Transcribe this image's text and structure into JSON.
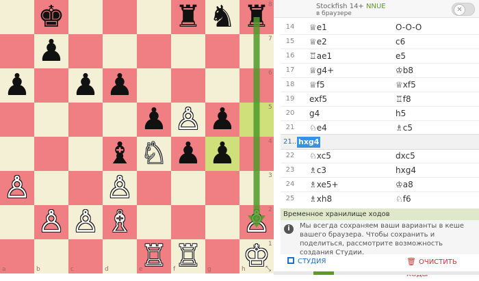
{
  "engine": {
    "name": "Stockfish 14+",
    "tag": "NNUE",
    "sub": "в браузере"
  },
  "moves": [
    {
      "num": "14",
      "w": "♕e1",
      "b": "O-O-O"
    },
    {
      "num": "15",
      "w": "♕e2",
      "b": "c6"
    },
    {
      "num": "16",
      "w": "♖ae1",
      "b": "e5"
    },
    {
      "num": "17",
      "w": "♕g4+",
      "b": "♔b8"
    },
    {
      "num": "18",
      "w": "♕f5",
      "b": "♕xf5"
    },
    {
      "num": "19",
      "w": "exf5",
      "b": "♖f8"
    },
    {
      "num": "20",
      "w": "g4",
      "b": "h5"
    },
    {
      "num": "21",
      "w": "♘e4",
      "b": "♗c5"
    }
  ],
  "variation": {
    "num": "21...",
    "move": "hxg4"
  },
  "moves2": [
    {
      "num": "22",
      "w": "♘xc5",
      "b": "dxc5"
    },
    {
      "num": "23",
      "w": "♗c3",
      "b": "hxg4"
    },
    {
      "num": "24",
      "w": "♗xe5+",
      "b": "♔a8"
    },
    {
      "num": "25",
      "w": "♗xh8",
      "b": "♘f6"
    }
  ],
  "storage": {
    "header": "Временное хранилище ходов",
    "text": "Мы всегда сохраняем ваши варианты в кеше вашего браузера. Чтобы сохранить и поделиться, рассмотрите возможность создания Студии.",
    "studio_label": "СТУДИЯ",
    "clear_label": "ОЧИСТИТЬ ХОДЫ"
  },
  "board": {
    "files": [
      "a",
      "b",
      "c",
      "d",
      "e",
      "f",
      "g",
      "h"
    ],
    "ranks": [
      "8",
      "7",
      "6",
      "5",
      "4",
      "3",
      "2",
      "1"
    ],
    "highlight_squares": [
      "h5",
      "g4"
    ],
    "pieces": [
      {
        "sq": "b8",
        "p": "♚",
        "c": "b"
      },
      {
        "sq": "f8",
        "p": "♜",
        "c": "b"
      },
      {
        "sq": "g8",
        "p": "♞",
        "c": "b"
      },
      {
        "sq": "h8",
        "p": "♜",
        "c": "b"
      },
      {
        "sq": "b7",
        "p": "♟",
        "c": "b"
      },
      {
        "sq": "a6",
        "p": "♟",
        "c": "b"
      },
      {
        "sq": "c6",
        "p": "♟",
        "c": "b"
      },
      {
        "sq": "d6",
        "p": "♟",
        "c": "b"
      },
      {
        "sq": "e5",
        "p": "♟",
        "c": "b"
      },
      {
        "sq": "f5",
        "p": "♙",
        "c": "w"
      },
      {
        "sq": "g5",
        "p": "♟",
        "c": "b"
      },
      {
        "sq": "d4",
        "p": "♝",
        "c": "b"
      },
      {
        "sq": "e4",
        "p": "♘",
        "c": "w"
      },
      {
        "sq": "f4",
        "p": "♟",
        "c": "b"
      },
      {
        "sq": "g4",
        "p": "♟",
        "c": "b"
      },
      {
        "sq": "a3",
        "p": "♙",
        "c": "w"
      },
      {
        "sq": "d3",
        "p": "♙",
        "c": "w"
      },
      {
        "sq": "b2",
        "p": "♙",
        "c": "w"
      },
      {
        "sq": "c2",
        "p": "♙",
        "c": "w"
      },
      {
        "sq": "d2",
        "p": "♗",
        "c": "w"
      },
      {
        "sq": "h2",
        "p": "♙",
        "c": "w"
      },
      {
        "sq": "e1",
        "p": "♖",
        "c": "w"
      },
      {
        "sq": "f1",
        "p": "♖",
        "c": "w"
      },
      {
        "sq": "h1",
        "p": "♔",
        "c": "w"
      }
    ],
    "arrow": {
      "from": "h8",
      "to": "h2",
      "color": "#4e9a2c"
    }
  },
  "colors": {
    "light": "#f3f0d6",
    "dark": "#ef7f82",
    "highlight": "#cfe07a"
  }
}
